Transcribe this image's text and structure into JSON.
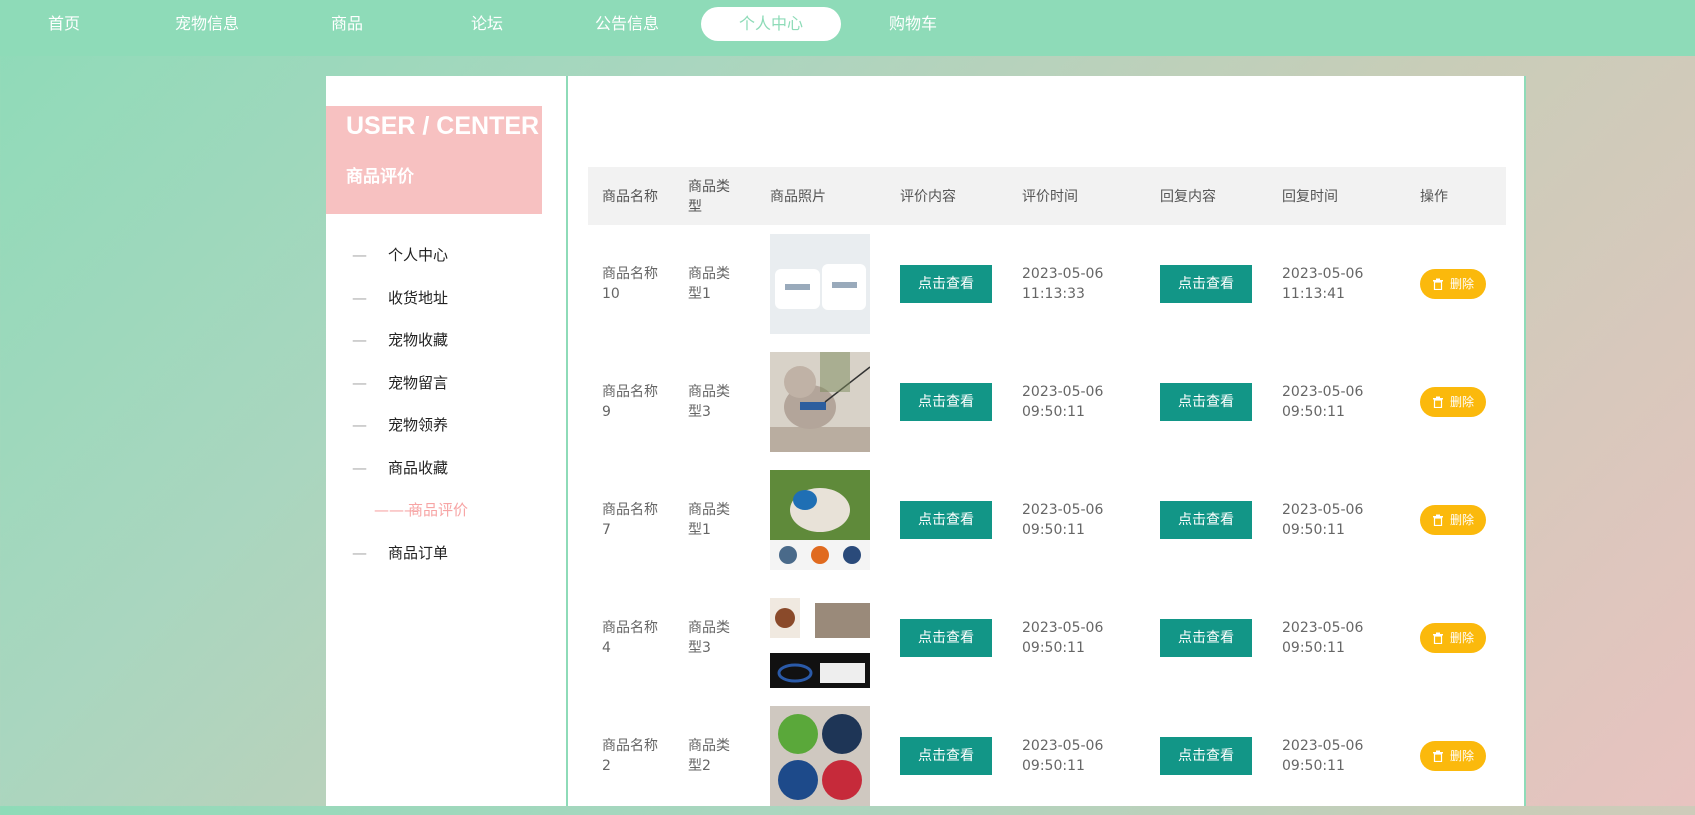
{
  "nav": {
    "items": [
      "首页",
      "宠物信息",
      "商品",
      "论坛",
      "公告信息",
      "个人中心",
      "购物车"
    ],
    "active": "个人中心"
  },
  "sidebar": {
    "title_en": "USER / CENTER",
    "title_cn": "商品评价",
    "items": [
      {
        "label": "个人中心"
      },
      {
        "label": "收货地址"
      },
      {
        "label": "宠物收藏"
      },
      {
        "label": "宠物留言"
      },
      {
        "label": "宠物领养"
      },
      {
        "label": "商品收藏"
      },
      {
        "label": "商品评价",
        "active": true
      },
      {
        "label": "商品订单"
      }
    ]
  },
  "table": {
    "headers": [
      "商品名称",
      "商品类型",
      "商品照片",
      "评价内容",
      "评价时间",
      "回复内容",
      "回复时间",
      "操作"
    ],
    "view_label": "点击查看",
    "delete_label": "删除",
    "rows": [
      {
        "name": "商品名称10",
        "type": "商品类型1",
        "photo": "pet-pads",
        "eval_time": "2023-05-06 11:13:33",
        "reply_time": "2023-05-06 11:13:41"
      },
      {
        "name": "商品名称9",
        "type": "商品类型3",
        "photo": "dog-harness",
        "eval_time": "2023-05-06 09:50:11",
        "reply_time": "2023-05-06 09:50:11"
      },
      {
        "name": "商品名称7",
        "type": "商品类型1",
        "photo": "dog-muzzle",
        "eval_time": "2023-05-06 09:50:11",
        "reply_time": "2023-05-06 09:50:11"
      },
      {
        "name": "商品名称4",
        "type": "商品类型3",
        "photo": "dog-collar",
        "eval_time": "2023-05-06 09:50:11",
        "reply_time": "2023-05-06 09:50:11"
      },
      {
        "name": "商品名称2",
        "type": "商品类型2",
        "photo": "pet-bowls",
        "eval_time": "2023-05-06 09:50:11",
        "reply_time": "2023-05-06 09:50:11"
      }
    ]
  },
  "colors": {
    "brand_green": "#8edbb8",
    "teal_button": "#129687",
    "delete_yellow": "#fbb90c",
    "accent_pink": "#f7c1c1"
  }
}
